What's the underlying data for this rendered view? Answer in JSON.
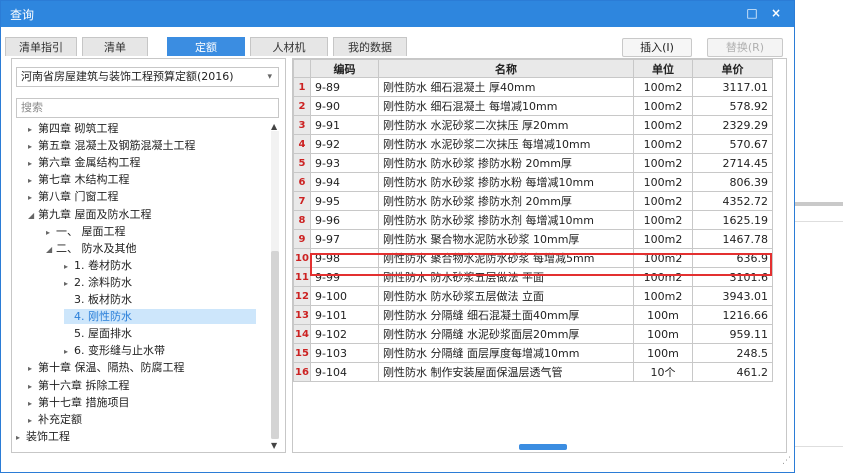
{
  "window": {
    "title": "查询",
    "restore_icon": "restore-icon",
    "close_icon": "close-icon",
    "restore_glyph": "□",
    "close_glyph": "×"
  },
  "tabs": [
    {
      "label": "清单指引",
      "active": false
    },
    {
      "label": "清单",
      "active": false
    },
    {
      "label": "定额",
      "active": true
    },
    {
      "label": "人材机",
      "active": false
    },
    {
      "label": "我的数据",
      "active": false
    }
  ],
  "buttons": {
    "insert": "插入(I)",
    "replace": "替换(R)"
  },
  "left": {
    "selected_quota": "河南省房屋建筑与装饰工程预算定额(2016)",
    "search_placeholder": "搜索",
    "tree": [
      {
        "label": "第四章 砌筑工程",
        "toggle": "▸",
        "level": 1
      },
      {
        "label": "第五章 混凝土及钢筋混凝土工程",
        "toggle": "▸",
        "level": 1
      },
      {
        "label": "第六章 金属结构工程",
        "toggle": "▸",
        "level": 1
      },
      {
        "label": "第七章 木结构工程",
        "toggle": "▸",
        "level": 1
      },
      {
        "label": "第八章 门窗工程",
        "toggle": "▸",
        "level": 1
      },
      {
        "label": "第九章 屋面及防水工程",
        "toggle": "◢",
        "level": 1
      },
      {
        "label": "一、 屋面工程",
        "toggle": "▸",
        "level": 2
      },
      {
        "label": "二、 防水及其他",
        "toggle": "◢",
        "level": 2
      },
      {
        "label": "1. 卷材防水",
        "toggle": "▸",
        "level": 3
      },
      {
        "label": "2. 涂料防水",
        "toggle": "▸",
        "level": 3
      },
      {
        "label": "3. 板材防水",
        "toggle": "",
        "level": 3
      },
      {
        "label": "4. 刚性防水",
        "toggle": "",
        "level": 3,
        "selected": true
      },
      {
        "label": "5. 屋面排水",
        "toggle": "",
        "level": 3
      },
      {
        "label": "6. 变形缝与止水带",
        "toggle": "▸",
        "level": 3
      },
      {
        "label": "第十章 保温、隔热、防腐工程",
        "toggle": "▸",
        "level": 1
      },
      {
        "label": "第十六章 拆除工程",
        "toggle": "▸",
        "level": 1
      },
      {
        "label": "第十七章 措施项目",
        "toggle": "▸",
        "level": 1
      },
      {
        "label": "补充定额",
        "toggle": "▸",
        "level": 1
      },
      {
        "label": "装饰工程",
        "toggle": "▸",
        "level": 0
      }
    ]
  },
  "grid": {
    "headers": {
      "code": "编码",
      "name": "名称",
      "unit": "单位",
      "price": "单价"
    },
    "rows": [
      {
        "n": "1",
        "code": "9-89",
        "name": "刚性防水 细石混凝土 厚40mm",
        "unit": "100m2",
        "price": "3117.01"
      },
      {
        "n": "2",
        "code": "9-90",
        "name": "刚性防水 细石混凝土 每增减10mm",
        "unit": "100m2",
        "price": "578.92"
      },
      {
        "n": "3",
        "code": "9-91",
        "name": "刚性防水 水泥砂浆二次抹压 厚20mm",
        "unit": "100m2",
        "price": "2329.29"
      },
      {
        "n": "4",
        "code": "9-92",
        "name": "刚性防水 水泥砂浆二次抹压 每增减10mm",
        "unit": "100m2",
        "price": "570.67"
      },
      {
        "n": "5",
        "code": "9-93",
        "name": "刚性防水 防水砂浆 掺防水粉 20mm厚",
        "unit": "100m2",
        "price": "2714.45"
      },
      {
        "n": "6",
        "code": "9-94",
        "name": "刚性防水 防水砂浆 掺防水粉 每增减10mm",
        "unit": "100m2",
        "price": "806.39"
      },
      {
        "n": "7",
        "code": "9-95",
        "name": "刚性防水 防水砂浆 掺防水剂 20mm厚",
        "unit": "100m2",
        "price": "4352.72"
      },
      {
        "n": "8",
        "code": "9-96",
        "name": "刚性防水 防水砂浆 掺防水剂 每增减10mm",
        "unit": "100m2",
        "price": "1625.19"
      },
      {
        "n": "9",
        "code": "9-97",
        "name": "刚性防水 聚合物水泥防水砂浆 10mm厚",
        "unit": "100m2",
        "price": "1467.78"
      },
      {
        "n": "10",
        "code": "9-98",
        "name": "刚性防水 聚合物水泥防水砂浆 每增减5mm",
        "unit": "100m2",
        "price": "636.9"
      },
      {
        "n": "11",
        "code": "9-99",
        "name": "刚性防水 防水砂浆五层做法 平面",
        "unit": "100m2",
        "price": "3101.6"
      },
      {
        "n": "12",
        "code": "9-100",
        "name": "刚性防水 防水砂浆五层做法 立面",
        "unit": "100m2",
        "price": "3943.01"
      },
      {
        "n": "13",
        "code": "9-101",
        "name": "刚性防水 分隔缝 细石混凝土面40mm厚",
        "unit": "100m",
        "price": "1216.66"
      },
      {
        "n": "14",
        "code": "9-102",
        "name": "刚性防水 分隔缝 水泥砂浆面层20mm厚",
        "unit": "100m",
        "price": "959.11"
      },
      {
        "n": "15",
        "code": "9-103",
        "name": "刚性防水 分隔缝 面层厚度每增减10mm",
        "unit": "100m",
        "price": "248.5"
      },
      {
        "n": "16",
        "code": "9-104",
        "name": "刚性防水 制作安装屋面保温层透气管",
        "unit": "10个",
        "price": "461.2"
      }
    ],
    "highlighted_row": 7
  },
  "colors": {
    "titlebar": "#2e86de",
    "active_tab": "#3b8de1",
    "highlight": "#e33030",
    "row_number": "#cc2222"
  }
}
